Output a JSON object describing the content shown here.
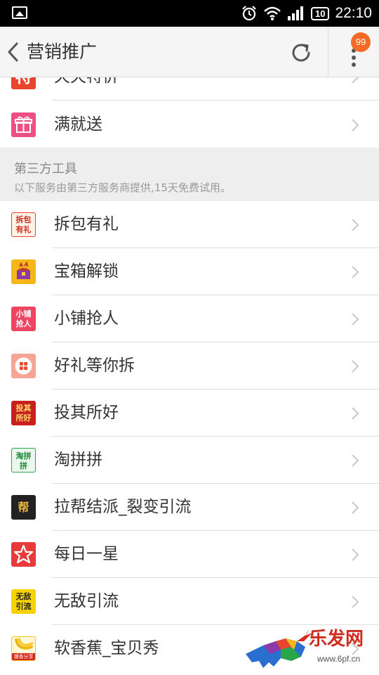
{
  "status_bar": {
    "time": "22:10",
    "battery": "10"
  },
  "header": {
    "title": "营销推广",
    "badge": "99"
  },
  "list_top": [
    {
      "label": "天天特价",
      "icon": "tiantian-tejia-icon",
      "color": "#e8452c"
    },
    {
      "label": "满就送",
      "icon": "gift-icon",
      "color": "#ee4f82"
    }
  ],
  "section": {
    "title": "第三方工具",
    "subtitle": "以下服务由第三方服务商提供,15天免费试用。"
  },
  "tools": [
    {
      "label": "拆包有礼",
      "icon": "chaibao-youli-icon",
      "color": "#e8452c"
    },
    {
      "label": "宝箱解锁",
      "icon": "treasure-box-icon",
      "color": "#f4b61a"
    },
    {
      "label": "小铺抢人",
      "icon": "xiaopu-qiangren-icon",
      "color": "#ee4563"
    },
    {
      "label": "好礼等你拆",
      "icon": "haoli-icon",
      "color": "#f39a8a"
    },
    {
      "label": "投其所好",
      "icon": "touqisuohao-icon",
      "color": "#d62a2a"
    },
    {
      "label": "淘拼拼",
      "icon": "taopinpin-icon",
      "color": "#2aa64a"
    },
    {
      "label": "拉帮结派_裂变引流",
      "icon": "labang-icon",
      "color": "#222222"
    },
    {
      "label": "每日一星",
      "icon": "star-icon",
      "color": "#e83a3a"
    },
    {
      "label": "无敌引流",
      "icon": "wudi-yinliu-icon",
      "color": "#f5d200"
    },
    {
      "label": "软香蕉_宝贝秀",
      "icon": "banana-icon",
      "color": "#f6c516"
    }
  ],
  "icon_text": {
    "tiantian": "特",
    "chaibao": "拆包有礼",
    "xiaopu": "小铺抢人",
    "touqi": "投其所好",
    "taopin": "淘拼拼",
    "labang": "帮",
    "wudi": "无敌引流",
    "banana": "潮香分享"
  },
  "watermark": {
    "text": "乐发网",
    "url": "www.6pf.cn"
  },
  "colors": {
    "accent": "#f46a25",
    "background": "#ffffff",
    "section_bg": "#eeeeee"
  }
}
